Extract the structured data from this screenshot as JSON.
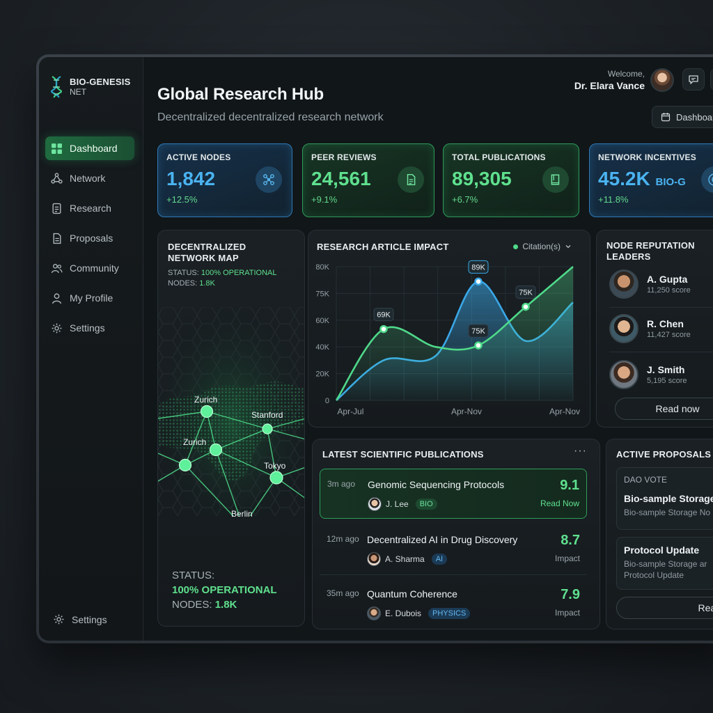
{
  "brand": {
    "name": "BIO-GENESIS",
    "sub": "NET"
  },
  "sidebar": {
    "items": [
      {
        "label": "Dashboard",
        "icon": "grid-icon",
        "active": true
      },
      {
        "label": "Network",
        "icon": "network-icon"
      },
      {
        "label": "Research",
        "icon": "document-icon"
      },
      {
        "label": "Proposals",
        "icon": "file-icon"
      },
      {
        "label": "Community",
        "icon": "people-icon"
      },
      {
        "label": "My Profile",
        "icon": "user-icon"
      },
      {
        "label": "Settings",
        "icon": "gear-icon"
      }
    ],
    "bottom_settings": "Settings"
  },
  "header": {
    "title": "Global Research Hub",
    "subtitle": "Decentralized decentralized research network",
    "welcome": "Welcome,",
    "user_name": "Dr. Elara Vance",
    "view_select": "Dashboard"
  },
  "stats": [
    {
      "label": "ACTIVE NODES",
      "value": "1,842",
      "unit": "",
      "change": "+12.5%",
      "theme": "blue",
      "icon": "nodes-icon"
    },
    {
      "label": "PEER REVIEWS",
      "value": "24,561",
      "unit": "",
      "change": "+9.1%",
      "theme": "green",
      "icon": "document-icon"
    },
    {
      "label": "TOTAL PUBLICATIONS",
      "value": "89,305",
      "unit": "",
      "change": "+6.7%",
      "theme": "green",
      "icon": "book-icon"
    },
    {
      "label": "NETWORK INCENTIVES",
      "value": "45.2K",
      "unit": "BIO-G",
      "change": "+11.8%",
      "theme": "blue",
      "icon": "coin-icon"
    }
  ],
  "map": {
    "title": "DECENTRALIZED NETWORK MAP",
    "status_label": "STATUS:",
    "status_value": "100% OPERATIONAL",
    "nodes_label": "NODES:",
    "nodes_value": "1.8K",
    "cities": [
      "Zurich",
      "Stanford",
      "Zurich",
      "Tokyo",
      "Berlin"
    ],
    "bottom_status_label": "STATUS:",
    "bottom_status_value": "100% OPERATIONAL",
    "bottom_nodes_label": "NODES:",
    "bottom_nodes_value": "1.8K"
  },
  "chart_data": {
    "type": "area",
    "title": "RESEARCH ARTICLE IMPACT",
    "legend": "Citation(s)",
    "x_ticks": [
      "Apr-Jul",
      "Apr-Nov",
      "Apr-Nov"
    ],
    "y_ticks": [
      "0",
      "20K",
      "40K",
      "60K",
      "75K",
      "80K"
    ],
    "series": [
      {
        "name": "Citation(s)",
        "color": "#4fd98a",
        "x": [
          0,
          0.2,
          0.42,
          0.6,
          0.8,
          1.0
        ],
        "values": [
          0,
          48000,
          36000,
          37000,
          63000,
          90000
        ]
      },
      {
        "color": "#3aa8e8",
        "x": [
          0,
          0.2,
          0.42,
          0.6,
          0.8,
          1.0
        ],
        "values": [
          0,
          27000,
          30000,
          80000,
          40000,
          66000
        ]
      }
    ],
    "annotations": [
      {
        "label": "69K",
        "series": 0,
        "point": 1
      },
      {
        "label": "89K",
        "series": 1,
        "point": 3
      },
      {
        "label": "75K",
        "series": 0,
        "point": 3
      },
      {
        "label": "75K",
        "series": 0,
        "point": 4
      }
    ]
  },
  "leaders": {
    "title": "NODE REPUTATION LEADERS",
    "items": [
      {
        "name": "A. Gupta",
        "score": "11,250 score"
      },
      {
        "name": "R. Chen",
        "score": "11,427 score"
      },
      {
        "name": "J. Smith",
        "score": "5,195 score"
      }
    ],
    "button": "Read now"
  },
  "publications": {
    "title": "LATEST SCIENTIFIC PUBLICATIONS",
    "items": [
      {
        "time": "3m ago",
        "title": "Genomic Sequencing Protocols",
        "author": "J. Lee",
        "tag": "BIO",
        "tag_type": "bio",
        "score": "9.1",
        "score_label": "Read Now"
      },
      {
        "time": "12m ago",
        "title": "Decentralized AI in Drug Discovery",
        "author": "A. Sharma",
        "tag": "AI",
        "tag_type": "ai",
        "score": "8.7",
        "score_label": "Impact"
      },
      {
        "time": "35m ago",
        "title": "Quantum Coherence",
        "author": "E. Dubois",
        "tag": "PHYSICS",
        "tag_type": "phys",
        "score": "7.9",
        "score_label": "Impact"
      }
    ]
  },
  "proposals": {
    "title": "ACTIVE PROPOSALS",
    "items": [
      {
        "kicker": "DAO VOTE",
        "title": "Bio-sample Storage",
        "desc": "Bio-sample Storage No"
      },
      {
        "kicker": "",
        "title": "Protocol Update",
        "desc": "Bio-sample Storage ar",
        "desc2": "Protocol Update"
      }
    ],
    "button": "Read N"
  },
  "colors": {
    "accent_green": "#5fe08e",
    "accent_blue": "#4ab3f0",
    "background": "#111619"
  }
}
